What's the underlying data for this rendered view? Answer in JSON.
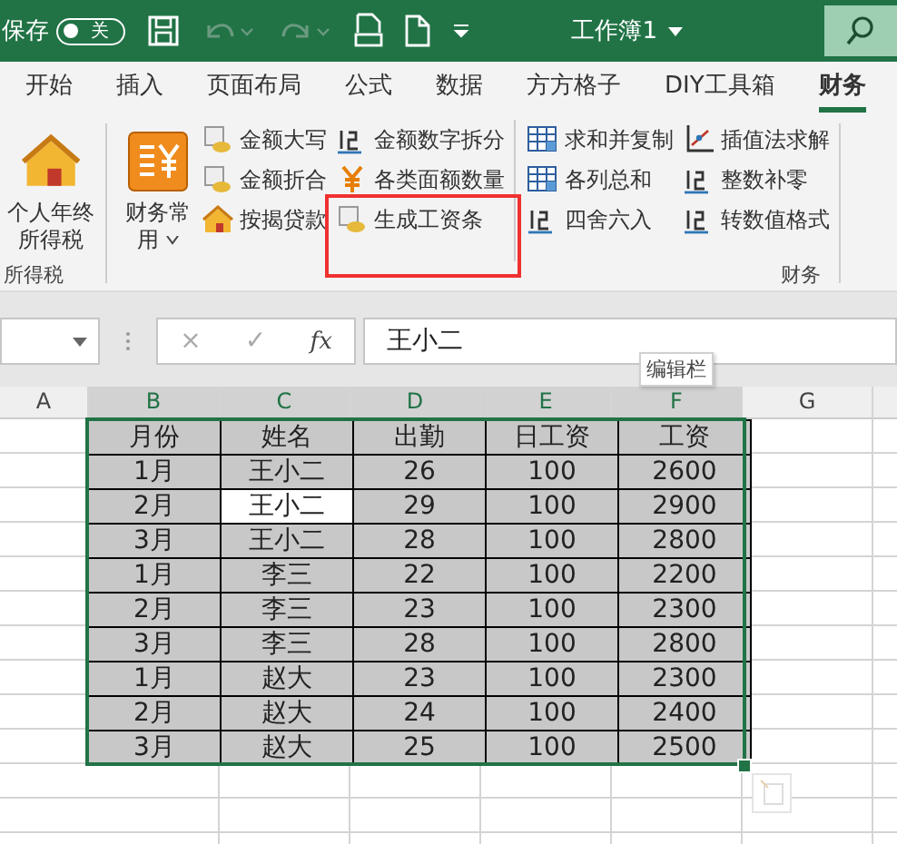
{
  "title_bar": {
    "autosave_label": "保存",
    "autosave_toggle": {
      "label": "关",
      "on": false
    },
    "title": "工作簿1"
  },
  "tabs": [
    {
      "label": "开始",
      "selected": false
    },
    {
      "label": "插入",
      "selected": false
    },
    {
      "label": "页面布局",
      "selected": false
    },
    {
      "label": "公式",
      "selected": false
    },
    {
      "label": "数据",
      "selected": false
    },
    {
      "label": "方方格子",
      "selected": false
    },
    {
      "label": "DIY工具箱",
      "selected": false
    },
    {
      "label": "财务",
      "selected": true
    }
  ],
  "ribbon": {
    "groups": [
      {
        "label": "所得税",
        "large": [
          {
            "label": "个人年终所得税",
            "dropdown": false
          }
        ]
      },
      {
        "label": "财务",
        "large": [
          {
            "label": "财务常用",
            "dropdown": true
          }
        ],
        "columns": [
          [
            {
              "label": "金额大写",
              "highlighted": false
            },
            {
              "label": "金额折合",
              "highlighted": false
            },
            {
              "label": "按揭贷款",
              "highlighted": false
            }
          ],
          [
            {
              "label": "金额数字拆分",
              "highlighted": false
            },
            {
              "label": "各类面额数量",
              "highlighted": false
            },
            {
              "label": "生成工资条",
              "highlighted": true
            }
          ],
          [
            {
              "label": "求和并复制",
              "highlighted": false
            },
            {
              "label": "各列总和",
              "highlighted": false
            },
            {
              "label": "四舍六入",
              "highlighted": false
            }
          ],
          [
            {
              "label": "插值法求解",
              "highlighted": false
            },
            {
              "label": "整数补零",
              "highlighted": false
            },
            {
              "label": "转数值格式",
              "highlighted": false
            }
          ]
        ]
      }
    ]
  },
  "formula_bar": {
    "cancel": "×",
    "enter": "✓",
    "function": "fx",
    "value": "王小二"
  },
  "tooltip": "编辑栏",
  "column_headers": [
    "A",
    "B",
    "C",
    "D",
    "E",
    "F",
    "G"
  ],
  "table": {
    "header": [
      "月份",
      "姓名",
      "出勤",
      "日工资",
      "工资"
    ],
    "rows": [
      [
        {
          "text": "1月",
          "selected": false
        },
        {
          "text": "王小二",
          "selected": false
        },
        {
          "text": "26",
          "selected": false
        },
        {
          "text": "100",
          "selected": false
        },
        {
          "text": "2600",
          "selected": false
        }
      ],
      [
        {
          "text": "2月",
          "selected": false
        },
        {
          "text": "王小二",
          "selected": true
        },
        {
          "text": "29",
          "selected": false
        },
        {
          "text": "100",
          "selected": false
        },
        {
          "text": "2900",
          "selected": false
        }
      ],
      [
        {
          "text": "3月",
          "selected": false
        },
        {
          "text": "王小二",
          "selected": false
        },
        {
          "text": "28",
          "selected": false
        },
        {
          "text": "100",
          "selected": false
        },
        {
          "text": "2800",
          "selected": false
        }
      ],
      [
        {
          "text": "1月",
          "selected": false
        },
        {
          "text": "李三",
          "selected": false
        },
        {
          "text": "22",
          "selected": false
        },
        {
          "text": "100",
          "selected": false
        },
        {
          "text": "2200",
          "selected": false
        }
      ],
      [
        {
          "text": "2月",
          "selected": false
        },
        {
          "text": "李三",
          "selected": false
        },
        {
          "text": "23",
          "selected": false
        },
        {
          "text": "100",
          "selected": false
        },
        {
          "text": "2300",
          "selected": false
        }
      ],
      [
        {
          "text": "3月",
          "selected": false
        },
        {
          "text": "李三",
          "selected": false
        },
        {
          "text": "28",
          "selected": false
        },
        {
          "text": "100",
          "selected": false
        },
        {
          "text": "2800",
          "selected": false
        }
      ],
      [
        {
          "text": "1月",
          "selected": false
        },
        {
          "text": "赵大",
          "selected": false
        },
        {
          "text": "23",
          "selected": false
        },
        {
          "text": "100",
          "selected": false
        },
        {
          "text": "2300",
          "selected": false
        }
      ],
      [
        {
          "text": "2月",
          "selected": false
        },
        {
          "text": "赵大",
          "selected": false
        },
        {
          "text": "24",
          "selected": false
        },
        {
          "text": "100",
          "selected": false
        },
        {
          "text": "2400",
          "selected": false
        }
      ],
      [
        {
          "text": "3月",
          "selected": false
        },
        {
          "text": "赵大",
          "selected": false
        },
        {
          "text": "25",
          "selected": false
        },
        {
          "text": "100",
          "selected": false
        },
        {
          "text": "2500",
          "selected": false
        }
      ]
    ]
  }
}
